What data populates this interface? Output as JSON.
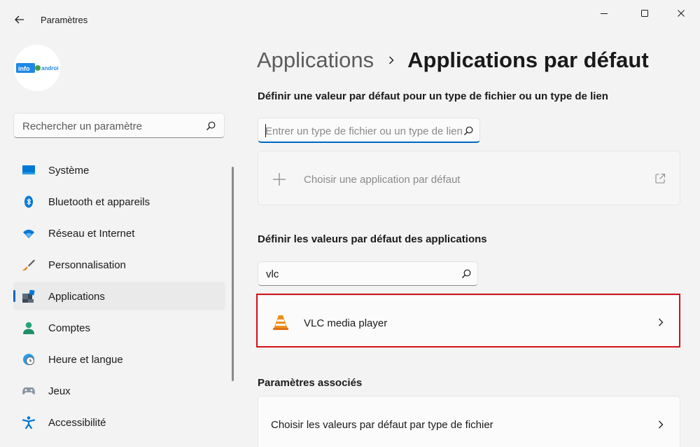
{
  "window": {
    "title": "Paramètres",
    "back_icon": "arrow-left-icon",
    "controls": [
      "minimize-icon",
      "maximize-icon",
      "close-icon"
    ]
  },
  "profile": {
    "avatar_text_1": "info",
    "avatar_text_2": "android",
    "avatar_colors": [
      "#1e88e5",
      "#43a047"
    ]
  },
  "sidebar": {
    "search": {
      "placeholder": "Rechercher un paramètre",
      "icon": "search-icon"
    },
    "items": [
      {
        "label": "Système",
        "icon": "display-icon",
        "selected": false
      },
      {
        "label": "Bluetooth et appareils",
        "icon": "bluetooth-icon",
        "selected": false
      },
      {
        "label": "Réseau et Internet",
        "icon": "wifi-icon",
        "selected": false
      },
      {
        "label": "Personnalisation",
        "icon": "brush-icon",
        "selected": false
      },
      {
        "label": "Applications",
        "icon": "apps-icon",
        "selected": true
      },
      {
        "label": "Comptes",
        "icon": "person-icon",
        "selected": false
      },
      {
        "label": "Heure et langue",
        "icon": "globe-clock-icon",
        "selected": false
      },
      {
        "label": "Jeux",
        "icon": "gamepad-icon",
        "selected": false
      },
      {
        "label": "Accessibilité",
        "icon": "accessibility-icon",
        "selected": false
      }
    ]
  },
  "main": {
    "breadcrumb": {
      "parent": "Applications",
      "current": "Applications par défaut"
    },
    "file_type_section": {
      "heading": "Définir une valeur par défaut pour un type de fichier ou un type de lien",
      "input_placeholder": "Entrer un type de fichier ou un type de lien",
      "choose_app_label": "Choisir une application par défaut"
    },
    "apps_section": {
      "heading": "Définir les valeurs par défaut des applications",
      "search_value": "vlc",
      "results": [
        {
          "label": "VLC media player",
          "icon": "vlc-cone-icon"
        }
      ]
    },
    "related_section": {
      "heading": "Paramètres associés",
      "items": [
        {
          "label": "Choisir les valeurs par défaut par type de fichier"
        }
      ]
    }
  },
  "colors": {
    "accent": "#0067c0",
    "highlight_border": "#d4121a",
    "background": "#f3f3f3"
  }
}
